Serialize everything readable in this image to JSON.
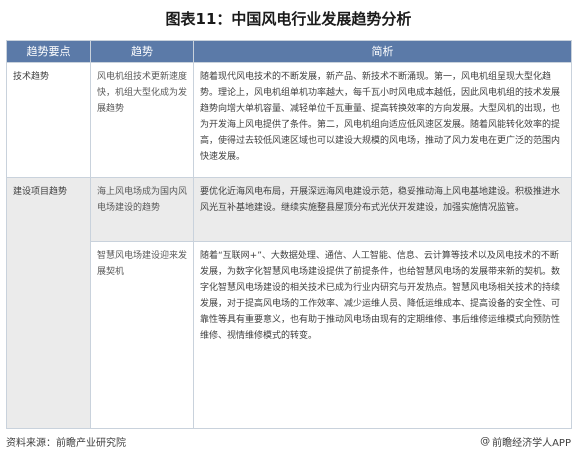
{
  "title": "图表11：中国风电行业发展趋势分析",
  "table": {
    "headers": [
      "趋势要点",
      "趋势",
      "简析"
    ],
    "rows": [
      {
        "category": "技术趋势",
        "trend": "风电机组技术更新速度快，机组大型化成为发展趋势",
        "analysis": "随着现代风电技术的不断发展，新产品、新技术不断涌现。第一，风电机组呈现大型化趋势。理论上，风电机组单机功率越大，每千瓦小时风电成本越低，因此风电机组的技术发展趋势向增大单机容量、减轻单位千瓦重量、提高转换效率的方向发展。大型风机的出现，也为开发海上风电提供了条件。第二，风电机组向适应低风速区发展。随着风能转化效率的提高，使得过去较低风速区域也可以建设大规模的风电场，推动了风力发电在更广泛的范围内快速发展。"
      },
      {
        "category": "建设项目趋势",
        "trend": "海上风电场成为国内风电场建设的趋势",
        "analysis": "要优化近海风电布局，开展深远海风电建设示范，稳妥推动海上风电基地建设。积极推进水风光互补基地建设。继续实施整县屋顶分布式光伏开发建设，加强实施情况监管。"
      },
      {
        "category": "",
        "trend": "智慧风电场建设迎来发展契机",
        "analysis": "随着“互联网+”、大数据处理、通信、人工智能、信息、云计算等技术以及风电技术的不断发展，为数字化智慧风电场建设提供了前提条件，也给智慧风电场的发展带来新的契机。数字化智慧风电场建设的相关技术已成为行业内研究与开发热点。智慧风电场相关技术的持续发展，对于提高风电场的工作效率、减少运维人员、降低运维成本、提高设备的安全性、可靠性等具有重要意义，也有助于推动风电场由现有的定期维修、事后维修运维模式向预防性维修、视情维修模式的转变。"
      }
    ]
  },
  "footer": {
    "source": "资料来源：前瞻产业研究院",
    "brand": "前瞻经济学人APP",
    "brand_icon": "at-icon"
  }
}
